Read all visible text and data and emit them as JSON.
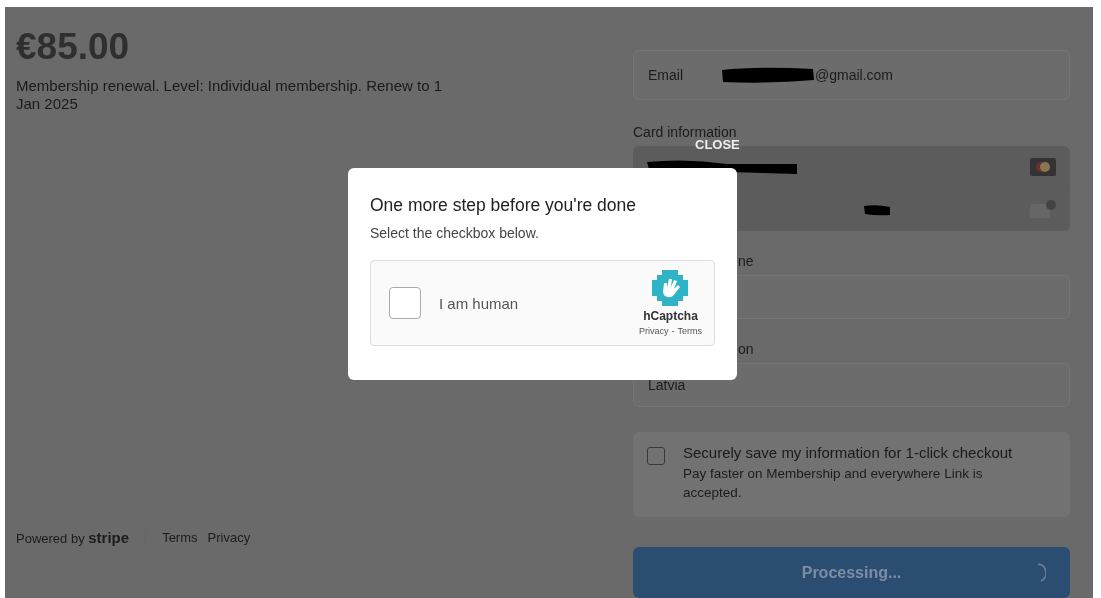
{
  "invoice": {
    "amount": "€85.00",
    "description": "Membership renewal. Level: Individual membership. Renew to 1 Jan 2025"
  },
  "footer": {
    "powered_by": "Powered by",
    "brand": "stripe",
    "links": [
      "Terms",
      "Privacy"
    ]
  },
  "form": {
    "email": {
      "label": "Email",
      "value": "@gmail.com"
    },
    "card_label": "Card information",
    "name_label": "ne",
    "country_label": "on",
    "country": "Latvia",
    "save": {
      "checked": false,
      "title": "Securely save my information for 1-click checkout",
      "subtitle": "Pay faster on Membership and everywhere Link is accepted."
    },
    "submit": "Processing..."
  },
  "close": "CLOSE",
  "modal": {
    "title": "One more step before you're done",
    "subtitle": "Select the checkbox below.",
    "captcha": {
      "label": "I am human",
      "checked": false,
      "brand": "hCaptcha",
      "links": [
        "Privacy",
        "Terms"
      ],
      "separator": "-"
    }
  }
}
